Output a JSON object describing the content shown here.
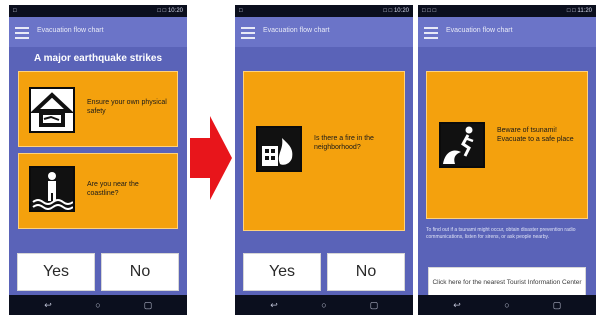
{
  "phone1": {
    "status_left": "□",
    "status_right": "□ □ 10:20",
    "app_title": "Evacuation flow chart",
    "headline": "A major earthquake strikes",
    "card1_text": "Ensure your own physical safety",
    "card2_text": "Are you near the coastline?",
    "yes_label": "Yes",
    "no_label": "No"
  },
  "phone2": {
    "status_left": "□",
    "status_right": "□ □ 10:20",
    "app_title": "Evacuation flow chart",
    "card_text": "Is there a fire in the neighborhood?",
    "yes_label": "Yes",
    "no_label": "No"
  },
  "phone3": {
    "status_left": "□ □ □",
    "status_right": "□ □ 11:20",
    "app_title": "Evacuation flow chart",
    "card_text": "Beware of tsunami! Evacuate to a safe place",
    "info_text": "To find out if a tsunami might occur, obtain disaster prevention radio communications, listen for sirens, or ask people nearby.",
    "tourist_button": "Click here for the nearest Tourist Information Center"
  },
  "colors": {
    "app_bg": "#5a63b8",
    "app_bar": "#6b74c8",
    "card": "#f4a10d",
    "status_bar": "#0b0f1e",
    "arrow": "#e8151b"
  }
}
